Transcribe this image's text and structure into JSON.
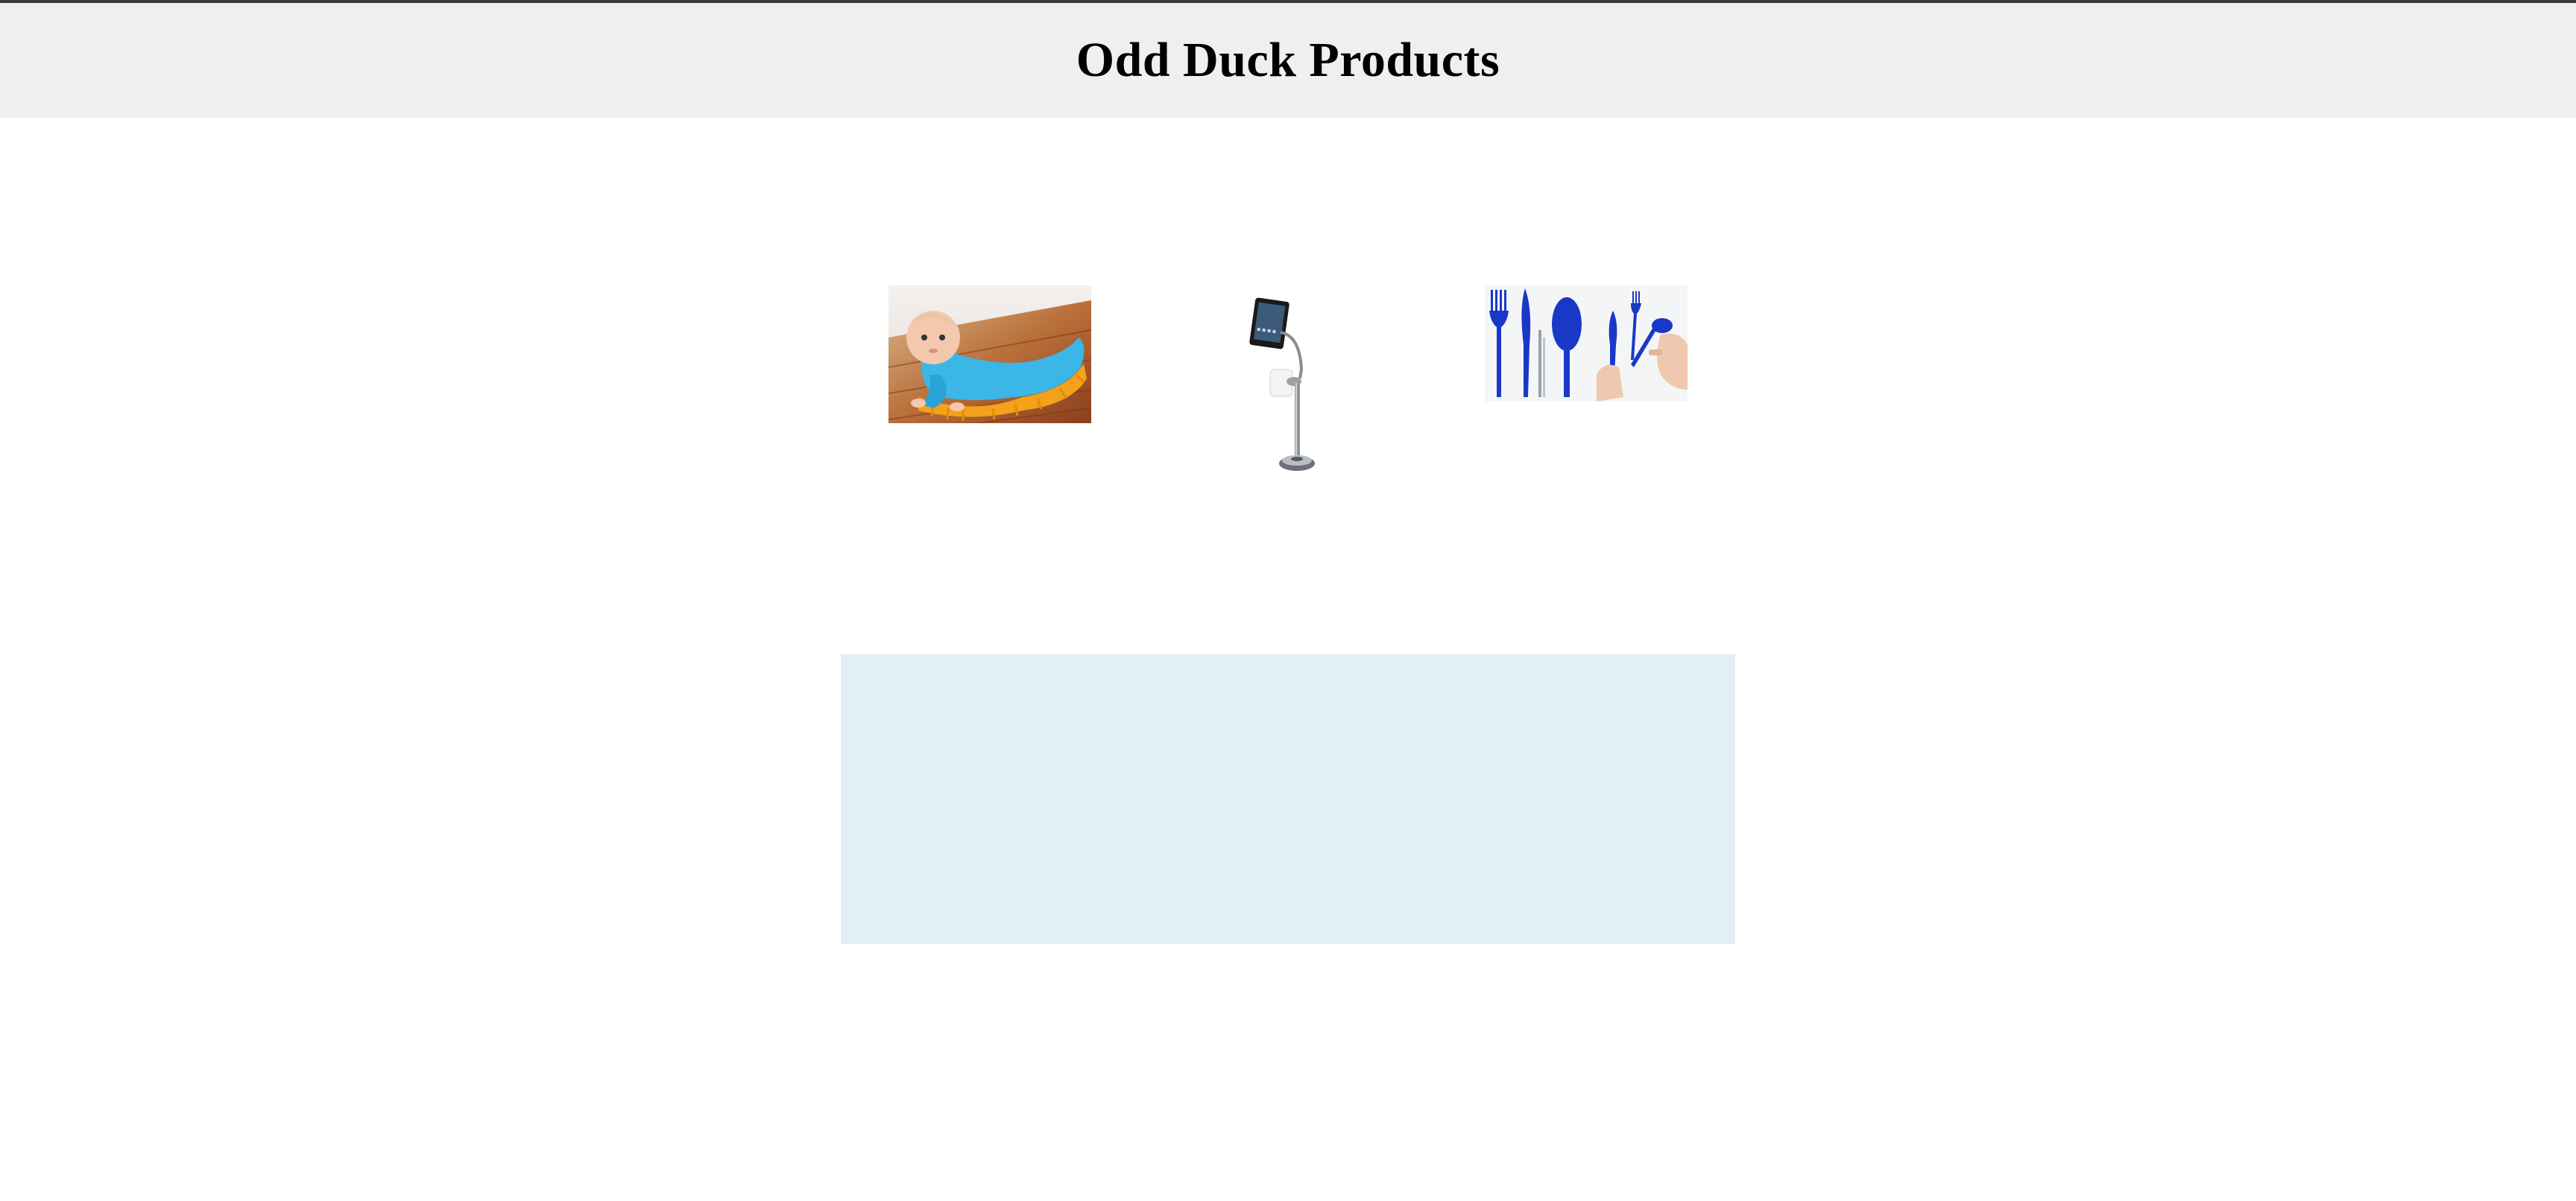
{
  "header": {
    "title": "Odd Duck Products"
  },
  "products": [
    {
      "name": "baby-mop",
      "icon": "baby-sweeper-onesie-image"
    },
    {
      "name": "tablet-toilet-stand",
      "icon": "ipad-toilet-paper-stand-image"
    },
    {
      "name": "blue-utensils",
      "icon": "blue-cutlery-set-image"
    }
  ],
  "colors": {
    "header_bg": "#efefef",
    "top_rule": "#3a3a3a",
    "results_bg": "#e2eff7"
  }
}
